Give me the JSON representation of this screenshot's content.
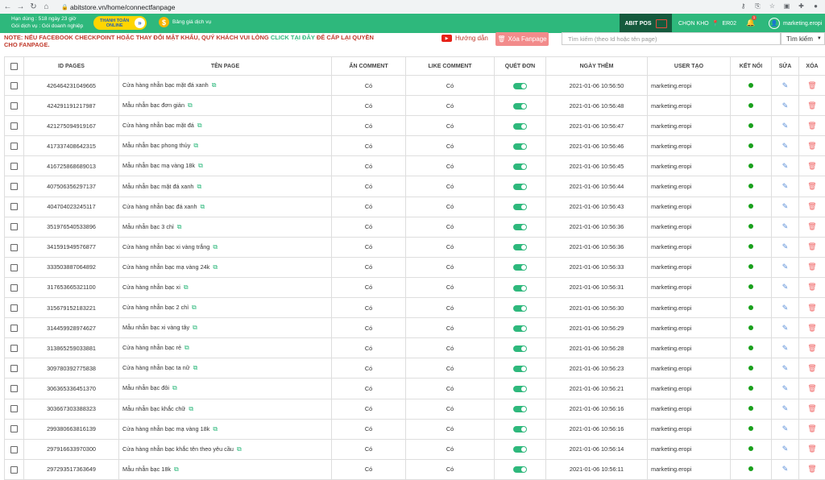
{
  "browser": {
    "url": "abitstore.vn/home/connectfanpage"
  },
  "header": {
    "plan_line1": "Hạn dùng : 518 ngày 23 giờ",
    "plan_line2": "Gói dịch vụ : Gói doanh nghiệp",
    "pay_line1": "THANH TOÁN",
    "pay_line2": "ONLINE",
    "price_label": "Bảng giá dịch vụ",
    "pos_label": "ABIT POS",
    "store_label": "CHỌN KHO",
    "store_code": "ER02",
    "notif_count": "1",
    "user_name": "marketing.eropi"
  },
  "notice": {
    "text_before": "NOTE: NẾU FACEBOOK CHECKPOINT HOẶC THAY ĐỔI MẬT KHẨU, QUÝ KHÁCH VUI LÒNG",
    "link_text": "CLICK TẠI ĐÂY",
    "text_after": "ĐỂ CẤP LẠI QUYỀN CHO FANPAGE."
  },
  "toolbar": {
    "guide_label": "Hướng dẫn",
    "delete_label": "Xóa Fanpage",
    "search_placeholder": "Tìm kiếm (theo Id hoặc tên page)",
    "search_button": "Tìm kiếm"
  },
  "table": {
    "columns": [
      "ID PAGES",
      "TÊN PAGE",
      "ẨN COMMENT",
      "LIKE COMMENT",
      "QUÉT ĐƠN",
      "NGÀY THÊM",
      "USER TẠO",
      "KẾT NỐI",
      "SỬA",
      "XÓA"
    ],
    "rows": [
      {
        "id": "426464231049665",
        "name": "Cửa hàng nhẫn bạc mặt đá xanh",
        "hide": "Có",
        "like": "Có",
        "date": "2021-01-06 10:56:50",
        "user": "marketing.eropi"
      },
      {
        "id": "424291191217987",
        "name": "Mẫu nhẫn bạc đơn giản",
        "hide": "Có",
        "like": "Có",
        "date": "2021-01-06 10:56:48",
        "user": "marketing.eropi"
      },
      {
        "id": "421275094919167",
        "name": "Cửa hàng nhẫn bạc mặt đá",
        "hide": "Có",
        "like": "Có",
        "date": "2021-01-06 10:56:47",
        "user": "marketing.eropi"
      },
      {
        "id": "417337408642315",
        "name": "Mẫu nhẫn bạc phong thủy",
        "hide": "Có",
        "like": "Có",
        "date": "2021-01-06 10:56:46",
        "user": "marketing.eropi"
      },
      {
        "id": "416725868689013",
        "name": "Mẫu nhẫn bạc mạ vàng 18k",
        "hide": "Có",
        "like": "Có",
        "date": "2021-01-06 10:56:45",
        "user": "marketing.eropi"
      },
      {
        "id": "407506356297137",
        "name": "Mẫu nhẫn bạc mặt đá xanh",
        "hide": "Có",
        "like": "Có",
        "date": "2021-01-06 10:56:44",
        "user": "marketing.eropi"
      },
      {
        "id": "404704023245117",
        "name": "Cửa hàng nhẫn bạc đá xanh",
        "hide": "Có",
        "like": "Có",
        "date": "2021-01-06 10:56:43",
        "user": "marketing.eropi"
      },
      {
        "id": "351976540533896",
        "name": "Mẫu nhẫn bạc 3 chỉ",
        "hide": "Có",
        "like": "Có",
        "date": "2021-01-06 10:56:36",
        "user": "marketing.eropi"
      },
      {
        "id": "341591949576877",
        "name": "Cửa hàng nhẫn bạc xi vàng trắng",
        "hide": "Có",
        "like": "Có",
        "date": "2021-01-06 10:56:36",
        "user": "marketing.eropi"
      },
      {
        "id": "333503887064892",
        "name": "Cửa hàng nhẫn bạc mạ vàng 24k",
        "hide": "Có",
        "like": "Có",
        "date": "2021-01-06 10:56:33",
        "user": "marketing.eropi"
      },
      {
        "id": "317653665321100",
        "name": "Cửa hàng nhẫn bạc xi",
        "hide": "Có",
        "like": "Có",
        "date": "2021-01-06 10:56:31",
        "user": "marketing.eropi"
      },
      {
        "id": "315679152183221",
        "name": "Cửa hàng nhẫn bạc 2 chỉ",
        "hide": "Có",
        "like": "Có",
        "date": "2021-01-06 10:56:30",
        "user": "marketing.eropi"
      },
      {
        "id": "314459928974627",
        "name": "Mẫu nhẫn bạc xi vàng tây",
        "hide": "Có",
        "like": "Có",
        "date": "2021-01-06 10:56:29",
        "user": "marketing.eropi"
      },
      {
        "id": "313865259033881",
        "name": "Cửa hàng nhẫn bạc rẻ",
        "hide": "Có",
        "like": "Có",
        "date": "2021-01-06 10:56:28",
        "user": "marketing.eropi"
      },
      {
        "id": "309780392775838",
        "name": "Cửa hàng nhẫn bạc ta nữ",
        "hide": "Có",
        "like": "Có",
        "date": "2021-01-06 10:56:23",
        "user": "marketing.eropi"
      },
      {
        "id": "306365336451370",
        "name": "Mẫu nhẫn bạc đôi",
        "hide": "Có",
        "like": "Có",
        "date": "2021-01-06 10:56:21",
        "user": "marketing.eropi"
      },
      {
        "id": "303667303388323",
        "name": "Mẫu nhẫn bạc khắc chữ",
        "hide": "Có",
        "like": "Có",
        "date": "2021-01-06 10:56:16",
        "user": "marketing.eropi"
      },
      {
        "id": "299380663816139",
        "name": "Cửa hàng nhẫn bạc mạ vàng 18k",
        "hide": "Có",
        "like": "Có",
        "date": "2021-01-06 10:56:16",
        "user": "marketing.eropi"
      },
      {
        "id": "297916633970300",
        "name": "Cửa hàng nhẫn bạc khắc tên theo yêu cầu",
        "hide": "Có",
        "like": "Có",
        "date": "2021-01-06 10:56:14",
        "user": "marketing.eropi"
      },
      {
        "id": "297293517363649",
        "name": "Mẫu nhẫn bạc 18k",
        "hide": "Có",
        "like": "Có",
        "date": "2021-01-06 10:56:11",
        "user": "marketing.eropi"
      }
    ]
  }
}
